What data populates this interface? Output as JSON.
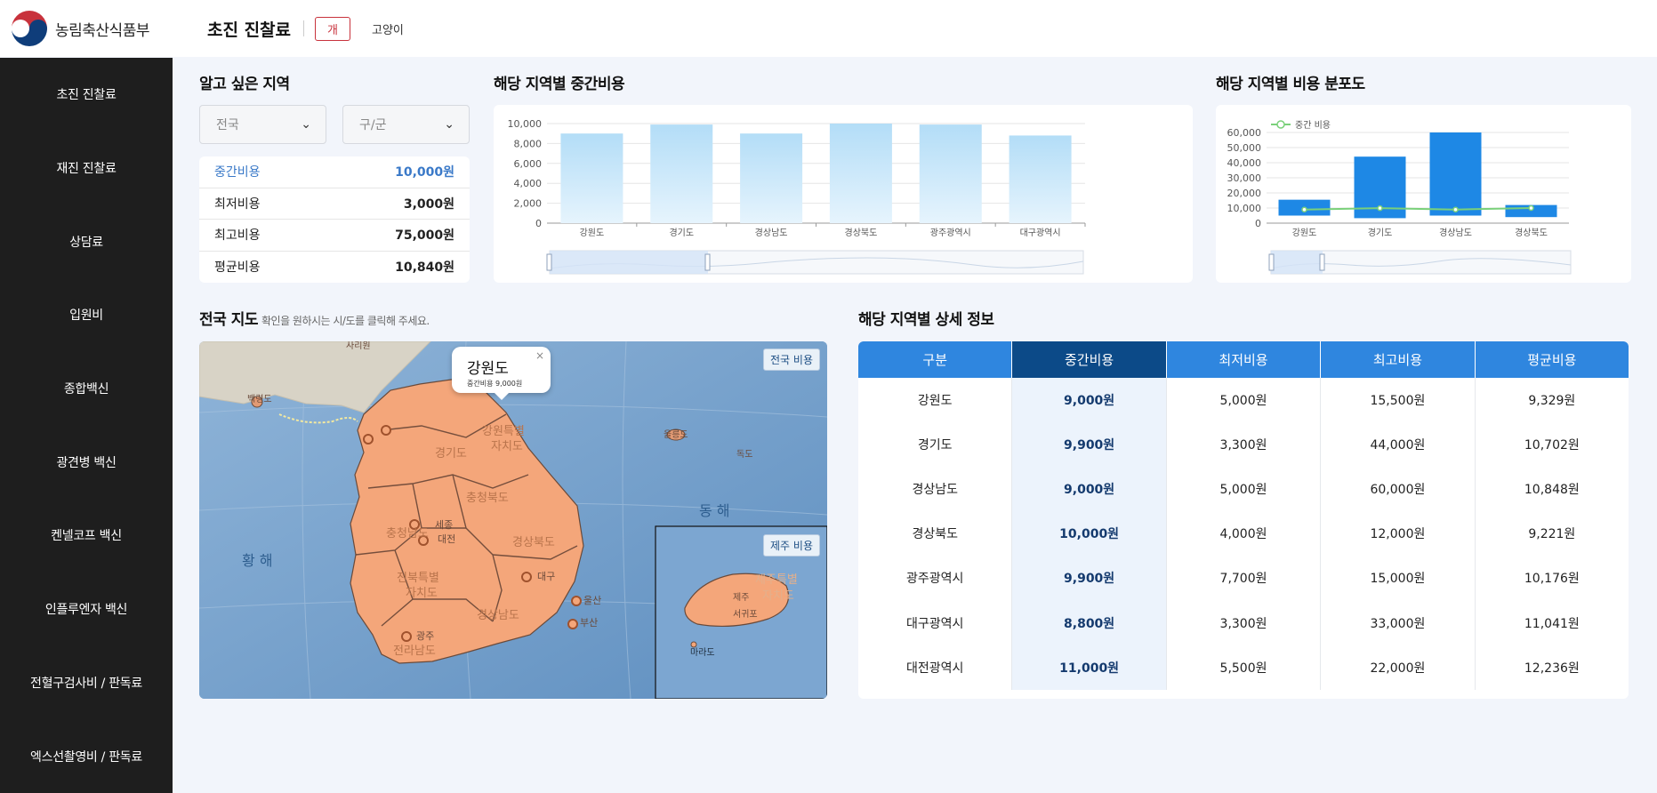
{
  "header": {
    "logo_text": "농림축산식품부",
    "page_title": "초진 진찰료",
    "pet_tabs": [
      "개",
      "고양이"
    ]
  },
  "sidebar": {
    "items": [
      {
        "label": "초진 진찰료"
      },
      {
        "label": "재진 진찰료"
      },
      {
        "label": "상담료"
      },
      {
        "label": "입원비"
      },
      {
        "label": "종합백신"
      },
      {
        "label": "광견병 백신"
      },
      {
        "label": "켄넬코프 백신"
      },
      {
        "label": "인플루엔자 백신"
      },
      {
        "label": "전혈구검사비 / 판독료"
      },
      {
        "label": "엑스선촬영비 / 판독료"
      }
    ]
  },
  "region": {
    "title": "알고 싶은 지역",
    "sido_placeholder": "전국",
    "gugun_placeholder": "구/군",
    "costs": [
      {
        "label": "중간비용",
        "value": "10,000원"
      },
      {
        "label": "최저비용",
        "value": "3,000원"
      },
      {
        "label": "최고비용",
        "value": "75,000원"
      },
      {
        "label": "평균비용",
        "value": "10,840원"
      }
    ]
  },
  "median_chart_title": "해당 지역별 중간비용",
  "dist_chart_title": "해당 지역별 비용 분포도",
  "chart_data": [
    {
      "type": "bar",
      "categories": [
        "강원도",
        "경기도",
        "경상남도",
        "경상북도",
        "광주광역시",
        "대구광역시"
      ],
      "values": [
        9000,
        9900,
        9000,
        10000,
        9900,
        8800
      ],
      "ylim": [
        0,
        10000
      ],
      "yticks": [
        "0",
        "2,000",
        "4,000",
        "6,000",
        "8,000",
        "10,000"
      ],
      "grid": true,
      "color": "#bfe3fa"
    },
    {
      "type": "bar",
      "categories": [
        "강원도",
        "경기도",
        "경상남도",
        "경상북도"
      ],
      "series": [
        {
          "low": 5000,
          "high": 15500
        },
        {
          "name": "중간 비용",
          "values": [
            9000,
            9900,
            9000,
            10000
          ]
        }
      ],
      "ylim": [
        0,
        60000
      ],
      "yticks": [
        "0",
        "10,000",
        "20,000",
        "30,000",
        "40,000",
        "50,000",
        "60,000"
      ],
      "ranges": [
        [
          5000,
          15500
        ],
        [
          3300,
          44000
        ],
        [
          5000,
          60000
        ],
        [
          4000,
          12000
        ]
      ],
      "legend_position": "top-left",
      "bar_color": "#1e88e5",
      "line_color": "#7ad07a",
      "grid": true
    }
  ],
  "map": {
    "title": "전국 지도",
    "hint": "확인을 원하시는 시/도를 클릭해 주세요.",
    "btn_nation": "전국 비용",
    "btn_jeju": "제주 비용",
    "popup_title": "강원도",
    "popup_sub": "중간비용 9,000원",
    "sea_west": "황 해",
    "sea_east": "동 해",
    "labels_main": [
      "강원특별",
      "자치도",
      "경기도",
      "충청북도",
      "세종",
      "대전",
      "충청남도",
      "경상북도",
      "대구",
      "울산",
      "전북특별",
      "자치도",
      "광주",
      "경상남도",
      "부산",
      "전라남도",
      "울릉도",
      "독도",
      "백령도",
      "사리원"
    ],
    "labels_jeju": [
      "제주특별",
      "자치도",
      "제주",
      "서귀포",
      "마라도"
    ]
  },
  "detail": {
    "title": "해당 지역별 상세 정보",
    "headers": [
      "구분",
      "중간비용",
      "최저비용",
      "최고비용",
      "평균비용"
    ],
    "rows": [
      [
        "강원도",
        "9,000원",
        "5,000원",
        "15,500원",
        "9,329원"
      ],
      [
        "경기도",
        "9,900원",
        "3,300원",
        "44,000원",
        "10,702원"
      ],
      [
        "경상남도",
        "9,000원",
        "5,000원",
        "60,000원",
        "10,848원"
      ],
      [
        "경상북도",
        "10,000원",
        "4,000원",
        "12,000원",
        "9,221원"
      ],
      [
        "광주광역시",
        "9,900원",
        "7,700원",
        "15,000원",
        "10,176원"
      ],
      [
        "대구광역시",
        "8,800원",
        "3,300원",
        "33,000원",
        "11,041원"
      ],
      [
        "대전광역시",
        "11,000원",
        "5,500원",
        "22,000원",
        "12,236원"
      ]
    ]
  }
}
